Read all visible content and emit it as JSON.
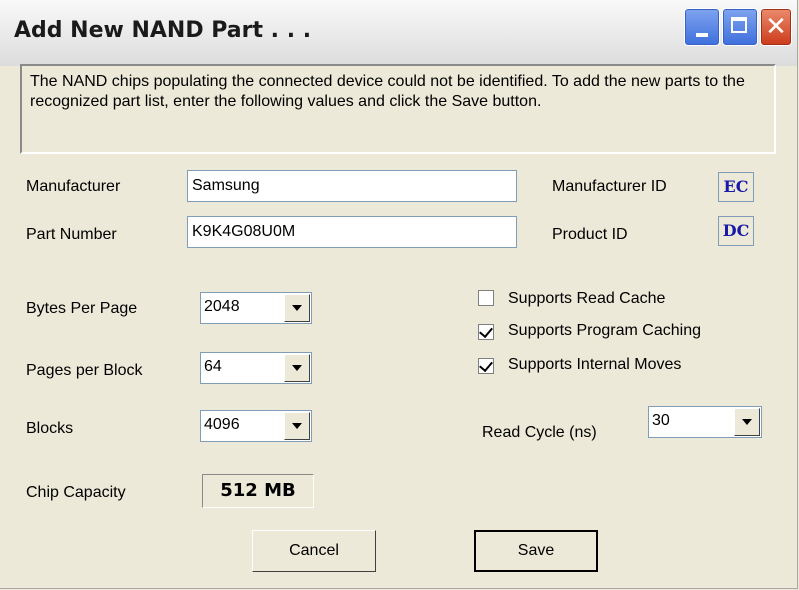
{
  "window": {
    "title": "Add New NAND Part . . .",
    "controls": {
      "minimize": "minimize-icon",
      "maximize": "maximize-icon",
      "close": "close-icon"
    }
  },
  "info_text": "The NAND chips populating the connected device could not be identified.  To add the new parts to the recognized part list, enter the following values and click the Save button.",
  "fields": {
    "manufacturer_label": "Manufacturer",
    "manufacturer_value": "Samsung",
    "part_number_label": "Part Number",
    "part_number_value": "K9K4G08U0M",
    "manufacturer_id_label": "Manufacturer ID",
    "manufacturer_id_value": "EC",
    "product_id_label": "Product ID",
    "product_id_value": "DC"
  },
  "selects": {
    "bytes_per_page_label": "Bytes Per Page",
    "bytes_per_page_value": "2048",
    "pages_per_block_label": "Pages per Block",
    "pages_per_block_value": "64",
    "blocks_label": "Blocks",
    "blocks_value": "4096",
    "read_cycle_label": "Read Cycle (ns)",
    "read_cycle_value": "30"
  },
  "checkboxes": [
    {
      "label": "Supports Read Cache",
      "checked": false
    },
    {
      "label": "Supports Program Caching",
      "checked": true
    },
    {
      "label": "Supports Internal Moves",
      "checked": true
    }
  ],
  "capacity": {
    "label": "Chip Capacity",
    "value": "512 MB"
  },
  "buttons": {
    "cancel": "Cancel",
    "save": "Save"
  }
}
